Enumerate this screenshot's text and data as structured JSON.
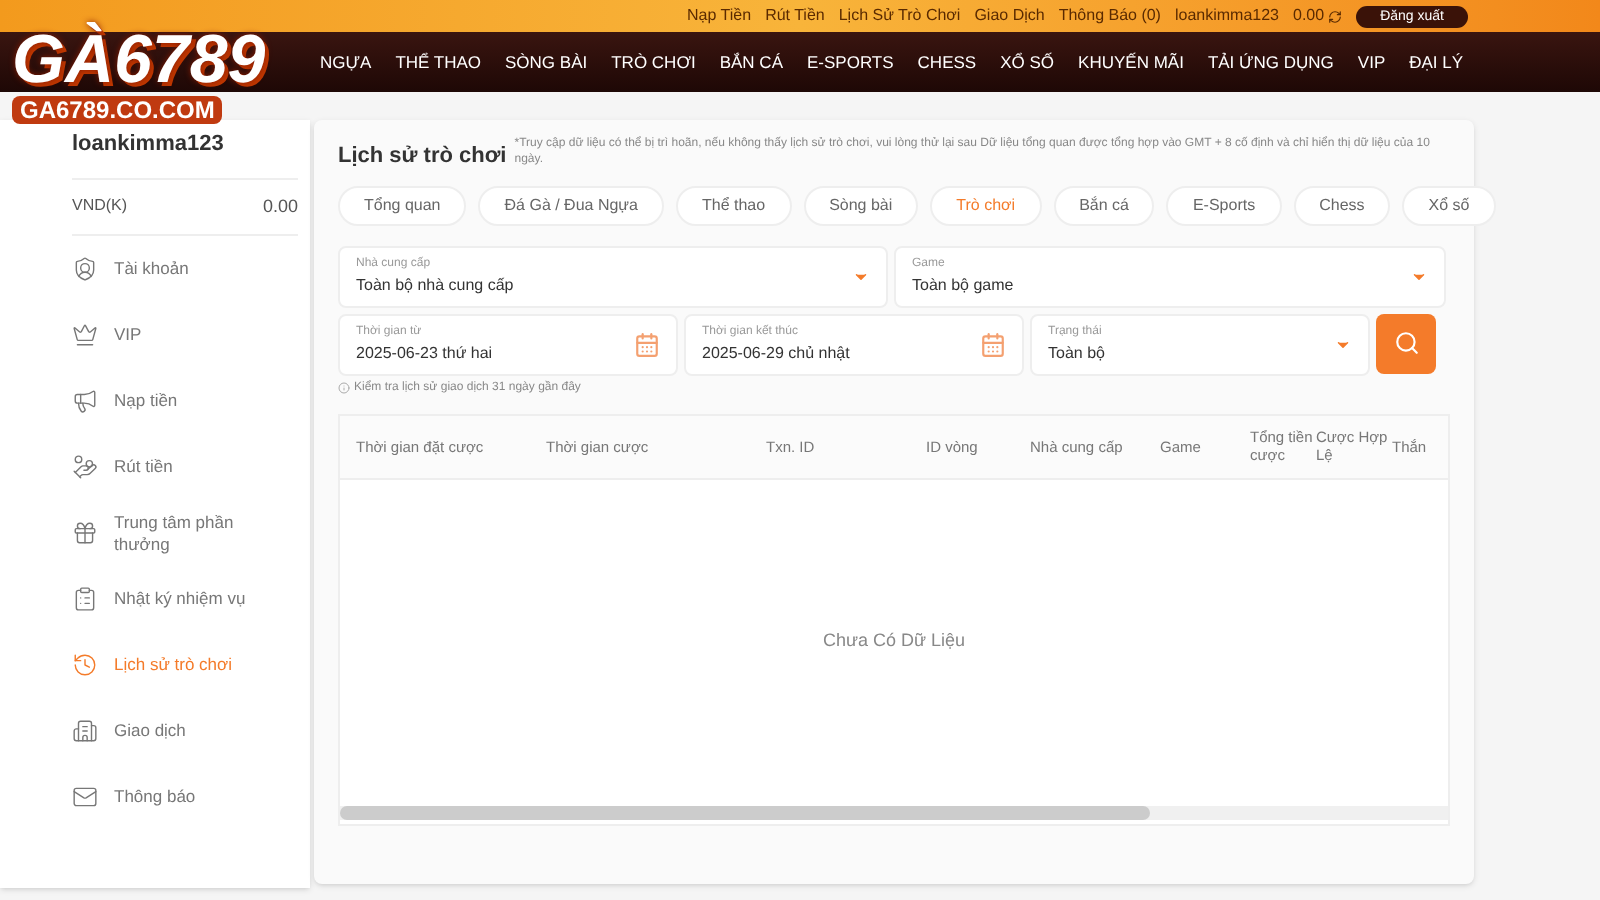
{
  "logo": {
    "text": "GÀ6789",
    "domain": "GA6789.CO.COM"
  },
  "top_links": [
    "Nạp Tiền",
    "Rút Tiền",
    "Lịch Sử Trò Chơi",
    "Giao Dịch",
    "Thông Báo (0)",
    "loankimma123",
    "0.00"
  ],
  "logout": "Đăng xuất",
  "nav": [
    "NGỰA",
    "THỂ THAO",
    "SÒNG BÀI",
    "TRÒ CHƠI",
    "BẮN CÁ",
    "E-SPORTS",
    "CHESS",
    "XỔ SỐ",
    "KHUYẾN MÃI",
    "TẢI ỨNG DỤNG",
    "VIP",
    "ĐẠI LÝ"
  ],
  "sidebar": {
    "username": "loankimma123",
    "currency": "VND(K)",
    "balance": "0.00",
    "items": [
      {
        "label": "Tài khoản",
        "kind": "account",
        "selected": false
      },
      {
        "label": "VIP",
        "kind": "vip",
        "selected": false
      },
      {
        "label": "Nạp tiền",
        "kind": "deposit",
        "selected": false
      },
      {
        "label": "Rút tiền",
        "kind": "withdraw",
        "selected": false
      },
      {
        "label": "Trung tâm phần thưởng",
        "kind": "reward",
        "selected": false
      },
      {
        "label": "Nhật ký nhiệm vụ",
        "kind": "tasks",
        "selected": false
      },
      {
        "label": "Lịch sử trò chơi",
        "kind": "history",
        "selected": true
      },
      {
        "label": "Giao dịch",
        "kind": "transactions",
        "selected": false
      },
      {
        "label": "Thông báo",
        "kind": "mail",
        "selected": false
      }
    ]
  },
  "page": {
    "title": "Lịch sử trò chơi",
    "note": "*Truy cập dữ liệu có thể bị trì hoãn, nếu không thấy lịch sử trò chơi, vui lòng thử lại sau Dữ liệu tổng quan được tổng hợp vào GMT + 8 cố định và chỉ hiển thị dữ liệu của 10 ngày."
  },
  "tabs": [
    {
      "label": "Tổng quan",
      "selected": false
    },
    {
      "label": "Đá Gà / Đua Ngựa",
      "selected": false
    },
    {
      "label": "Thể thao",
      "selected": false
    },
    {
      "label": "Sòng bài",
      "selected": false
    },
    {
      "label": "Trò chơi",
      "selected": true
    },
    {
      "label": "Bắn cá",
      "selected": false
    },
    {
      "label": "E-Sports",
      "selected": false
    },
    {
      "label": "Chess",
      "selected": false
    },
    {
      "label": "Xổ số",
      "selected": false
    }
  ],
  "filters": {
    "provider": {
      "label": "Nhà cung cấp",
      "value": "Toàn bộ nhà cung cấp"
    },
    "game": {
      "label": "Game",
      "value": "Toàn bộ game"
    },
    "date_from": {
      "label": "Thời gian từ",
      "value": "2025-06-23 thứ hai"
    },
    "date_to": {
      "label": "Thời gian kết thúc",
      "value": "2025-06-29 chủ nhật"
    },
    "status": {
      "label": "Trạng thái",
      "value": "Toàn bộ"
    },
    "hint": "Kiểm tra lịch sử giao dịch 31 ngày gần đây"
  },
  "table": {
    "columns": [
      "Thời gian đặt cược",
      "Thời gian cược",
      "Txn. ID",
      "ID vòng",
      "Nhà cung cấp",
      "Game",
      "Tổng tiền cược",
      "Cược Hợp Lệ",
      "Thắn"
    ],
    "empty": "Chưa Có Dữ Liệu"
  }
}
